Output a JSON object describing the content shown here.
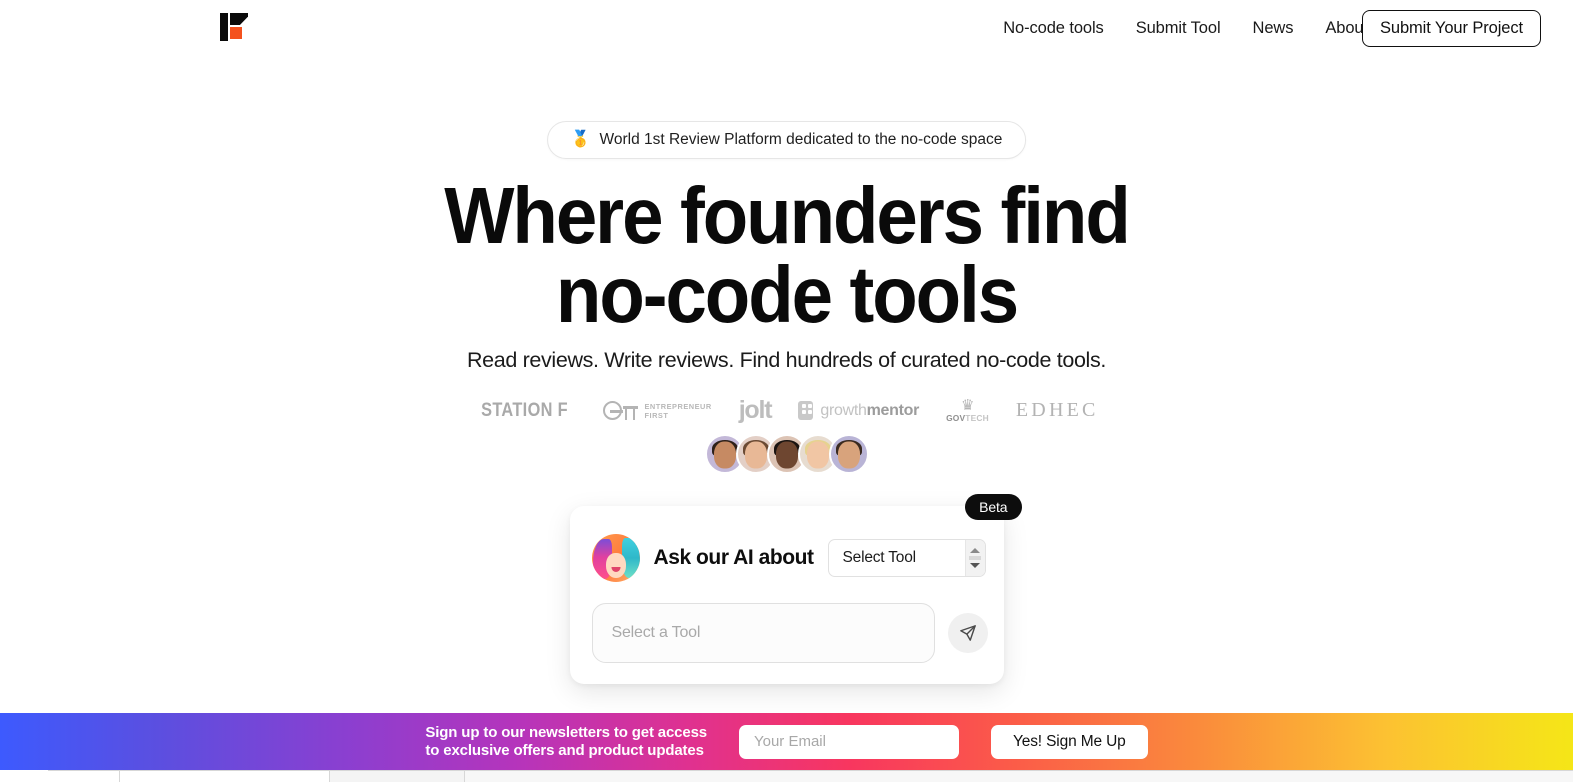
{
  "header": {
    "logo_name": "findmytool-logo",
    "nav": [
      {
        "label": "No-code tools"
      },
      {
        "label": "Submit Tool"
      },
      {
        "label": "News"
      },
      {
        "label": "About"
      }
    ],
    "cta_label": "Submit Your Project"
  },
  "hero": {
    "badge_emoji": "🥇",
    "badge_text": "World 1st Review Platform dedicated to the no-code space",
    "headline_line1": "Where founders find",
    "headline_line2": "no-code tools",
    "subtitle": "Read reviews. Write reviews. Find hundreds of curated no-code tools."
  },
  "partners": [
    {
      "name": "station-f",
      "label": "STATION F"
    },
    {
      "name": "entrepreneur-first",
      "label_line1": "ENTREPRENEUR",
      "label_line2": "FIRST"
    },
    {
      "name": "jolt",
      "label": "jolt"
    },
    {
      "name": "growthmentor",
      "label_light": "growth",
      "label_bold": "mentor"
    },
    {
      "name": "govtech",
      "label_a": "GOV",
      "label_b": "TECH",
      "crown": "♛"
    },
    {
      "name": "edhec",
      "label": "EDHEC"
    }
  ],
  "avatars": {
    "count": 5,
    "names": [
      "avatar-1",
      "avatar-2",
      "avatar-3",
      "avatar-4",
      "avatar-5"
    ]
  },
  "ai_card": {
    "beta_label": "Beta",
    "title": "Ask our AI about",
    "select_value": "Select Tool",
    "input_placeholder": "Select a Tool",
    "send_icon": "send-paper-plane-icon"
  },
  "newsletter": {
    "line1": "Sign up to our newsletters to get access",
    "line2": "to exclusive offers and product updates",
    "email_placeholder": "Your Email",
    "email_value": "",
    "submit_label": "Yes! Sign Me Up"
  },
  "colors": {
    "logo_accent": "#f4511e",
    "text_primary": "#0a0a0a",
    "badge_black": "#0d0d0d",
    "gradient_start": "#3d5afe",
    "gradient_mid": "#f8365f",
    "gradient_end": "#f5e617"
  }
}
